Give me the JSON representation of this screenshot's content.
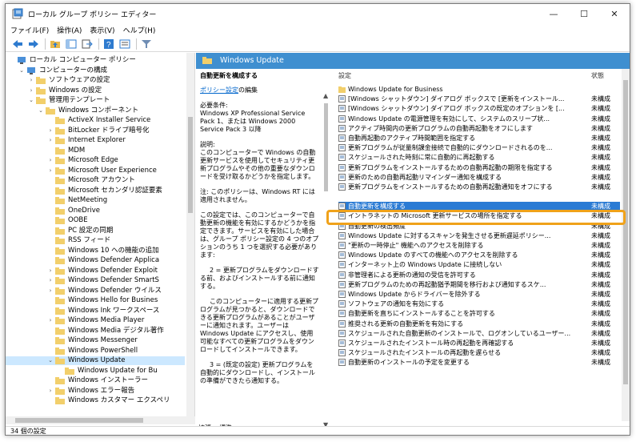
{
  "window": {
    "title": "ローカル グループ ポリシー エディター",
    "controls": [
      "—",
      "☐",
      "✕"
    ]
  },
  "menu": [
    "ファイル(F)",
    "操作(A)",
    "表示(V)",
    "ヘルプ(H)"
  ],
  "tree": {
    "items": [
      {
        "label": "ローカル コンピューター ポリシー",
        "indent": 0,
        "arrow": "",
        "selected": false
      },
      {
        "label": "コンピューターの構成",
        "indent": 1,
        "arrow": "v",
        "selected": false
      },
      {
        "label": "ソフトウェアの設定",
        "indent": 2,
        "arrow": ">",
        "selected": false
      },
      {
        "label": "Windows の設定",
        "indent": 2,
        "arrow": ">",
        "selected": false
      },
      {
        "label": "管理用テンプレート",
        "indent": 2,
        "arrow": "v",
        "selected": false
      },
      {
        "label": "Windows コンポーネント",
        "indent": 3,
        "arrow": "v",
        "selected": false
      },
      {
        "label": "ActiveX Installer Service",
        "indent": 4,
        "arrow": "",
        "selected": false
      },
      {
        "label": "BitLocker ドライブ暗号化",
        "indent": 4,
        "arrow": ">",
        "selected": false
      },
      {
        "label": "Internet Explorer",
        "indent": 4,
        "arrow": ">",
        "selected": false
      },
      {
        "label": "MDM",
        "indent": 4,
        "arrow": "",
        "selected": false
      },
      {
        "label": "Microsoft Edge",
        "indent": 4,
        "arrow": ">",
        "selected": false
      },
      {
        "label": "Microsoft User Experience",
        "indent": 4,
        "arrow": ">",
        "selected": false
      },
      {
        "label": "Microsoft アカウント",
        "indent": 4,
        "arrow": "",
        "selected": false
      },
      {
        "label": "Microsoft セカンダリ認証要素",
        "indent": 4,
        "arrow": "",
        "selected": false
      },
      {
        "label": "NetMeeting",
        "indent": 4,
        "arrow": "",
        "selected": false
      },
      {
        "label": "OneDrive",
        "indent": 4,
        "arrow": "",
        "selected": false
      },
      {
        "label": "OOBE",
        "indent": 4,
        "arrow": "",
        "selected": false
      },
      {
        "label": "PC 設定の同期",
        "indent": 4,
        "arrow": "",
        "selected": false
      },
      {
        "label": "RSS フィード",
        "indent": 4,
        "arrow": "",
        "selected": false
      },
      {
        "label": "Windows 10 への機能の追加",
        "indent": 4,
        "arrow": "",
        "selected": false
      },
      {
        "label": "Windows Defender Applica",
        "indent": 4,
        "arrow": "",
        "selected": false
      },
      {
        "label": "Windows Defender Exploit",
        "indent": 4,
        "arrow": ">",
        "selected": false
      },
      {
        "label": "Windows Defender SmartS",
        "indent": 4,
        "arrow": ">",
        "selected": false
      },
      {
        "label": "Windows Defender ウイルス",
        "indent": 4,
        "arrow": ">",
        "selected": false
      },
      {
        "label": "Windows Hello for Busines",
        "indent": 4,
        "arrow": "",
        "selected": false
      },
      {
        "label": "Windows Ink ワークスペース",
        "indent": 4,
        "arrow": "",
        "selected": false
      },
      {
        "label": "Windows Media Player",
        "indent": 4,
        "arrow": ">",
        "selected": false
      },
      {
        "label": "Windows Media デジタル著作",
        "indent": 4,
        "arrow": "",
        "selected": false
      },
      {
        "label": "Windows Messenger",
        "indent": 4,
        "arrow": "",
        "selected": false
      },
      {
        "label": "Windows PowerShell",
        "indent": 4,
        "arrow": "",
        "selected": false
      },
      {
        "label": "Windows Update",
        "indent": 4,
        "arrow": "v",
        "selected": true
      },
      {
        "label": "Windows Update for Bu",
        "indent": 5,
        "arrow": "",
        "selected": false
      },
      {
        "label": "Windows インストーラー",
        "indent": 4,
        "arrow": "",
        "selected": false
      },
      {
        "label": "Windows エラー報告",
        "indent": 4,
        "arrow": ">",
        "selected": false
      },
      {
        "label": "Windows カスタマー エクスペリ",
        "indent": 4,
        "arrow": "",
        "selected": false
      }
    ]
  },
  "header": {
    "title": "Windows Update"
  },
  "description": {
    "title": "自動更新を構成する",
    "edit_prefix": "ポリシー設定",
    "edit_suffix": "の編集",
    "req_label": "必要条件:",
    "requirements": "Windows XP Professional Service Pack 1、または Windows 2000 Service Pack 3 以降",
    "desc_label": "説明:",
    "description": "このコンピューターで Windows の自動更新サービスを使用してセキュリティ更新プログラムやその他の重要なダウンロードを受け取るかどうかを指定します。",
    "note": "注: このポリシーは、Windows RT には適用されません。",
    "para1": "この設定では、このコンピューターで自動更新の機能を有効にするかどうかを指定できます。サービスを有効にした場合は、グループ ポリシー設定の 4 つのオプションのうち 1 つを選択する必要があります:",
    "para2": "2 = 更新プログラムをダウンロードする前、およびインストールする前に通知する。",
    "para3": "このコンピューターに適用する更新プログラムが見つかると、ダウンロードできる更新プログラムがあることがユーザーに通知されます。ユーザーは Windows Update にアクセスし、使用可能なすべての更新プログラムをダウンロードしてインストールできます。",
    "para4": "3 = (既定の設定) 更新プログラムを自動的にダウンロードし、インストールの準備ができたら通知する。"
  },
  "list": {
    "col_setting": "設定",
    "col_state": "状態",
    "rows": [
      {
        "name": "Windows Update for Business",
        "state": "",
        "kind": "folder",
        "selected": false
      },
      {
        "name": "[Windows シャットダウン] ダイアログ ボックスで [更新をインストール...",
        "state": "未構成",
        "kind": "policy",
        "selected": false
      },
      {
        "name": "[Windows シャットダウン] ダイアログ ボックスの既定のオプションを [...",
        "state": "未構成",
        "kind": "policy",
        "selected": false
      },
      {
        "name": "Windows Update の電源管理を有効にして、システムのスリープ状...",
        "state": "未構成",
        "kind": "policy",
        "selected": false
      },
      {
        "name": "アクティブ時間内の更新プログラムの自動再起動をオフにします",
        "state": "未構成",
        "kind": "policy",
        "selected": false
      },
      {
        "name": "自動再起動のアクティブ時間範囲を指定する",
        "state": "未構成",
        "kind": "policy",
        "selected": false
      },
      {
        "name": "更新プログラムが従量制課金接続で自動的にダウンロードされるのを...",
        "state": "未構成",
        "kind": "policy",
        "selected": false
      },
      {
        "name": "スケジュールされた時刻に常に自動的に再起動する",
        "state": "未構成",
        "kind": "policy",
        "selected": false
      },
      {
        "name": "更新プログラムをインストールするための自動再起動の期限を指定する",
        "state": "未構成",
        "kind": "policy",
        "selected": false
      },
      {
        "name": "更新のための自動再起動リマインダー通知を構成する",
        "state": "未構成",
        "kind": "policy",
        "selected": false
      },
      {
        "name": "更新プログラムをインストールするための自動再起動通知をオフにする",
        "state": "未構成",
        "kind": "policy",
        "selected": false
      },
      {
        "name": "自動更新を構成する",
        "state": "未構成",
        "kind": "policy",
        "selected": true
      },
      {
        "name": "イントラネットの Microsoft 更新サービスの場所を指定する",
        "state": "未構成",
        "kind": "policy",
        "selected": false
      },
      {
        "name": "自動更新の検出頻度",
        "state": "未構成",
        "kind": "policy",
        "selected": false
      },
      {
        "name": "Windows Update に対するスキャンを発生させる更新遅延ポリシー...",
        "state": "未構成",
        "kind": "policy",
        "selected": false
      },
      {
        "name": "\"更新の一時停止\" 機能へのアクセスを削除する",
        "state": "未構成",
        "kind": "policy",
        "selected": false
      },
      {
        "name": "Windows Update のすべての機能へのアクセスを削除する",
        "state": "未構成",
        "kind": "policy",
        "selected": false
      },
      {
        "name": "インターネット上の Windows Update に接続しない",
        "state": "未構成",
        "kind": "policy",
        "selected": false
      },
      {
        "name": "非管理者による更新の通知の受信を許可する",
        "state": "未構成",
        "kind": "policy",
        "selected": false
      },
      {
        "name": "更新プログラムのための再起動猶予期間を移行および通知するスケ...",
        "state": "未構成",
        "kind": "policy",
        "selected": false
      },
      {
        "name": "Windows Update からドライバーを除外する",
        "state": "未構成",
        "kind": "policy",
        "selected": false
      },
      {
        "name": "ソフトウェアの通知を有効にする",
        "state": "未構成",
        "kind": "policy",
        "selected": false
      },
      {
        "name": "自動更新を直ちにインストールすることを許可する",
        "state": "未構成",
        "kind": "policy",
        "selected": false
      },
      {
        "name": "推奨される更新の自動更新を有効にする",
        "state": "未構成",
        "kind": "policy",
        "selected": false
      },
      {
        "name": "スケジュールされた自動更新のインストールで、ログオンしているユーザー...",
        "state": "未構成",
        "kind": "policy",
        "selected": false
      },
      {
        "name": "スケジュールされたインストール時の再起動を再確認する",
        "state": "未構成",
        "kind": "policy",
        "selected": false
      },
      {
        "name": "スケジュールされたインストールの再起動を遅らせる",
        "state": "未構成",
        "kind": "policy",
        "selected": false
      },
      {
        "name": "自動更新のインストールの予定を変更する",
        "state": "未構成",
        "kind": "policy",
        "selected": false
      }
    ]
  },
  "tabs": [
    "拡張",
    "標準"
  ],
  "status": "34 個の設定",
  "colors": {
    "accent": "#3f8fd0",
    "selection": "#2a7bd4",
    "highlight_box": "#f0a21a",
    "folder": "#e8b84a"
  }
}
